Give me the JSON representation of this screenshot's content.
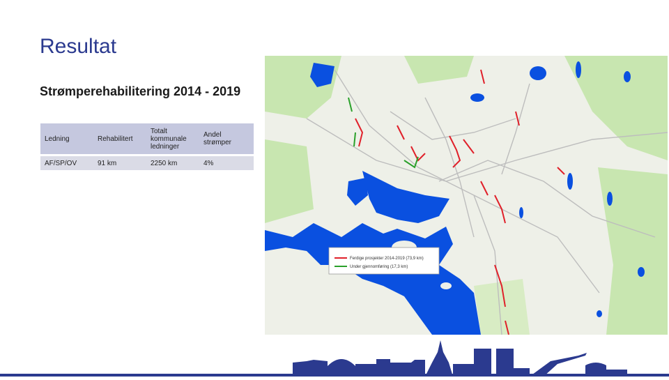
{
  "slide": {
    "title": "Resultat",
    "subtitle": "Strømperehabilitering 2014 - 2019"
  },
  "table": {
    "headers": [
      "Ledning",
      "Rehabilitert",
      "Totalt kommunale ledninger",
      "Andel strømper"
    ],
    "rows": [
      [
        "AF/SP/OV",
        "91 km",
        "2250 km",
        "4%"
      ]
    ]
  },
  "map": {
    "legend": [
      {
        "label": "Ferdige prosjekter 2014-2019 (73,9 km)",
        "color": "#e0202a"
      },
      {
        "label": "Under gjennomføring (17,3 km)",
        "color": "#2aa02a"
      }
    ],
    "colors": {
      "water": "#0a50e0",
      "land": "#eef0e8",
      "green": "#c8e6b0",
      "roads": "#bdbdbd"
    }
  },
  "footer": {
    "skyline_color": "#2b3a8f"
  }
}
